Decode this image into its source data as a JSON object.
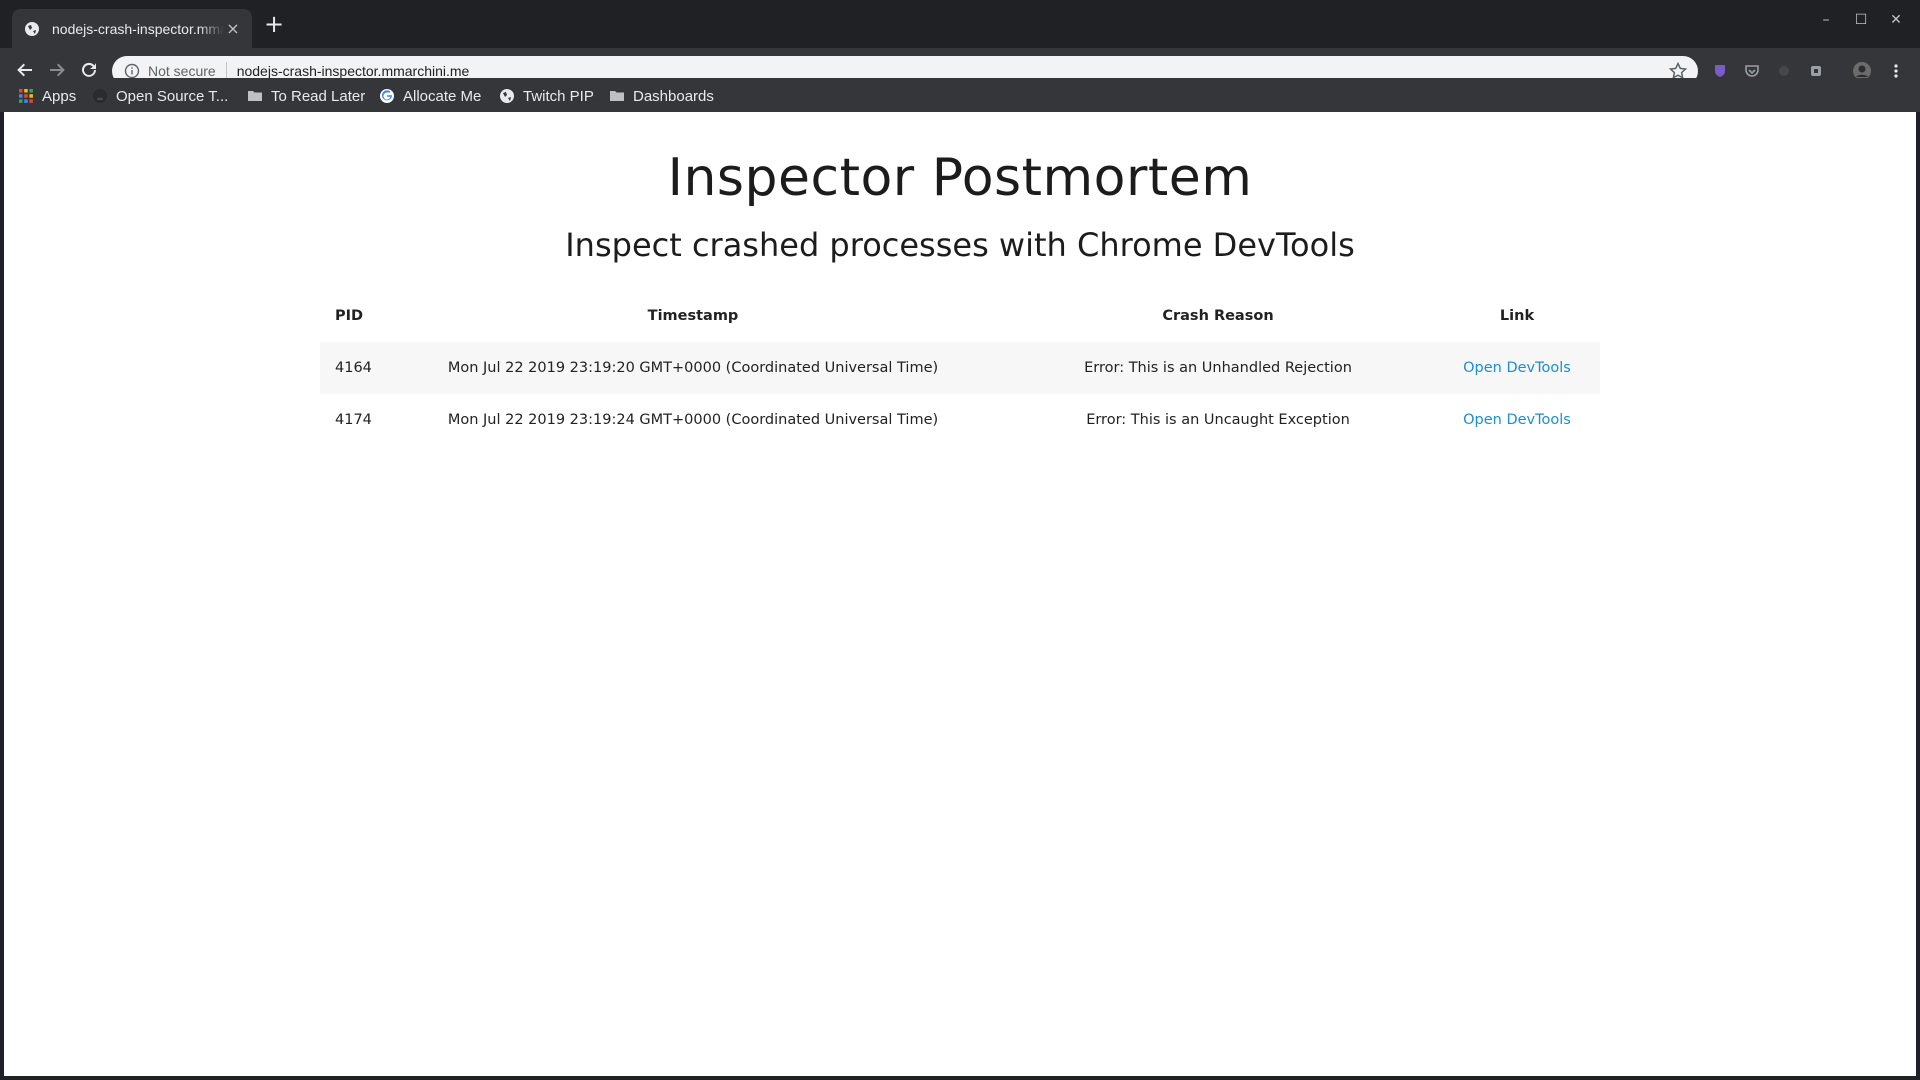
{
  "browser": {
    "tab": {
      "title": "nodejs-crash-inspector.mmarchini.me",
      "close": "×"
    },
    "new_tab": "+",
    "window_controls": {
      "minimize": "–",
      "maximize": "☐",
      "close": "✕"
    },
    "omnibox": {
      "security_label": "Not secure",
      "url": "nodejs-crash-inspector.mmarchini.me"
    },
    "bookmarks": [
      {
        "label": "Apps",
        "icon": "apps-grid-icon"
      },
      {
        "label": "Open Source T...",
        "icon": "github-icon"
      },
      {
        "label": "To Read Later",
        "icon": "folder-icon"
      },
      {
        "label": "Allocate Me",
        "icon": "google-icon"
      },
      {
        "label": "Twitch PIP",
        "icon": "globe-icon"
      },
      {
        "label": "Dashboards",
        "icon": "folder-icon"
      }
    ]
  },
  "page": {
    "title": "Inspector Postmortem",
    "subtitle": "Inspect crashed processes with Chrome DevTools",
    "table": {
      "headers": {
        "pid": "PID",
        "timestamp": "Timestamp",
        "reason": "Crash Reason",
        "link": "Link"
      },
      "rows": [
        {
          "pid": "4164",
          "timestamp": "Mon Jul 22 2019 23:19:20 GMT+0000 (Coordinated Universal Time)",
          "reason": "Error: This is an Unhandled Rejection",
          "link": "Open DevTools"
        },
        {
          "pid": "4174",
          "timestamp": "Mon Jul 22 2019 23:19:24 GMT+0000 (Coordinated Universal Time)",
          "reason": "Error: This is an Uncaught Exception",
          "link": "Open DevTools"
        }
      ]
    }
  },
  "colors": {
    "link": "#1a8fd6",
    "chrome_dark": "#35363a",
    "frame": "#202124"
  }
}
